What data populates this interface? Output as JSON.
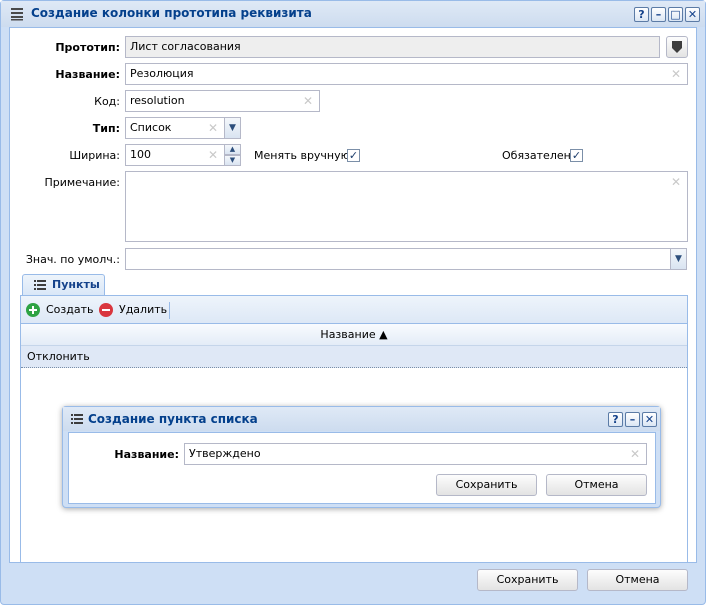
{
  "window": {
    "title": "Создание колонки прототипа реквизита",
    "tools": {
      "help": "?",
      "minimize": "–",
      "maximize": "□",
      "close": "✕"
    }
  },
  "form": {
    "prototype_label": "Прототип:",
    "prototype_value": "Лист согласования",
    "name_label": "Название:",
    "name_value": "Резолюция",
    "code_label": "Код:",
    "code_value": "resolution",
    "type_label": "Тип:",
    "type_value": "Список",
    "width_label": "Ширина:",
    "width_value": "100",
    "manual_label": "Менять вручную:",
    "manual_checked": true,
    "required_label": "Обязателен:",
    "required_checked": true,
    "note_label": "Примечание:",
    "note_value": "",
    "default_label": "Знач. по умолч.:",
    "default_value": ""
  },
  "items_tab": {
    "label": "Пункты",
    "create_label": "Создать",
    "delete_label": "Удалить",
    "column_header": "Название ▲",
    "rows": [
      "Отклонить"
    ]
  },
  "sub_dialog": {
    "title": "Создание пункта списка",
    "name_label": "Название:",
    "name_value": "Утверждено",
    "save_label": "Сохранить",
    "cancel_label": "Отмена"
  },
  "footer": {
    "save_label": "Сохранить",
    "cancel_label": "Отмена"
  },
  "colors": {
    "title_text": "#04408c",
    "window_frame": "#cedff5",
    "create_icon": "#2ea343",
    "delete_icon": "#d9363e"
  }
}
